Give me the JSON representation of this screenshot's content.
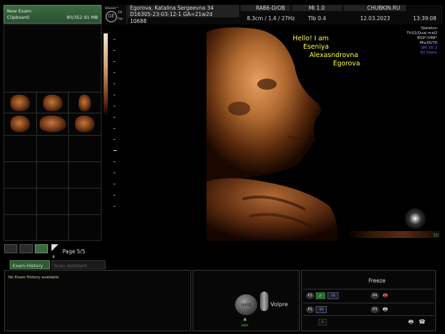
{
  "clipboard": {
    "title": "New Exam:",
    "label": "Clipboard:",
    "size": "90/352.91 MB"
  },
  "pagination": {
    "label": "Page 5/5",
    "small_num": "4"
  },
  "tabs": [
    {
      "label": "Exam-History"
    },
    {
      "label": "Scan Assistant"
    }
  ],
  "history": {
    "message": "No Exam History available"
  },
  "controls": {
    "axis_label": "axis",
    "volpre_label": "Volpre",
    "axis_caption": "axis",
    "axis_arrow": "▲"
  },
  "freeze": {
    "label": "Freeze",
    "keys": [
      "P2",
      "P4",
      "P1",
      "P3"
    ],
    "p2_box": "1D",
    "p1_box": "3D",
    "small_box": "≡",
    "check": "✓",
    "printer": "🖶",
    "phone": "☎"
  },
  "header": {
    "brand": "Voluson™",
    "logo": "GE",
    "eb": "E6",
    "fap": "Fap",
    "patient_name": "Egorova, Katalina Sergeevna 34",
    "patient_id": "D16305-23-03-12-1  GA=21w2d",
    "exam_num": "10688",
    "probe": "RAB6-D/OB",
    "scan_params": "8.3cm / 1.4 / 27Hz",
    "mi": "MI  1.0",
    "tib": "TIb  0.4",
    "site": "CHUBKIN.RU",
    "date": "12.03.2023",
    "time": "13:39:08"
  },
  "image": {
    "greeting": [
      "Hello! I am",
      "Eseniya",
      "Alexasndrovna",
      "Egorova"
    ],
    "render_info": [
      {
        "text": "Skeleton",
        "color": "#dddddd"
      },
      {
        "text": "Th32/Qual mid2",
        "color": "#dddddd"
      },
      {
        "text": "B59°/V88°",
        "color": "#dddddd"
      },
      {
        "text": "Mix30/70",
        "color": "#dddddd"
      },
      {
        "text": "SRI 3D 2",
        "color": "#6a6aff"
      },
      {
        "text": "3D Static",
        "color": "#6a6aff"
      }
    ],
    "ref_label": "3D"
  },
  "colors": {
    "accent_green": "#2f5a33",
    "greeting": "#ffff44"
  }
}
